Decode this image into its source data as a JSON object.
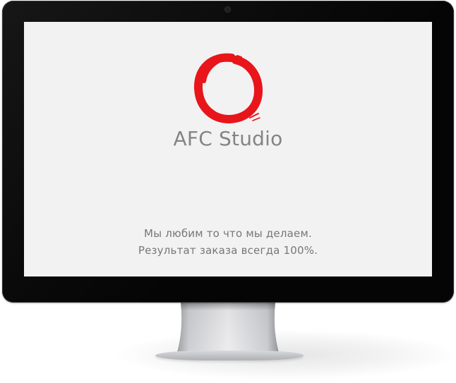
{
  "screen": {
    "brand": "AFC Studio",
    "tagline_line1": "Мы любим то что мы делаем.",
    "tagline_line2": "Результат заказа всегда 100%."
  },
  "colors": {
    "bezel": "#050505",
    "screen_background": "#f2f2f2",
    "logo_red": "#e8151b",
    "brand_text": "#848486",
    "tagline_text": "#777779"
  },
  "icons": {
    "logo": "enso-circle-logo"
  }
}
